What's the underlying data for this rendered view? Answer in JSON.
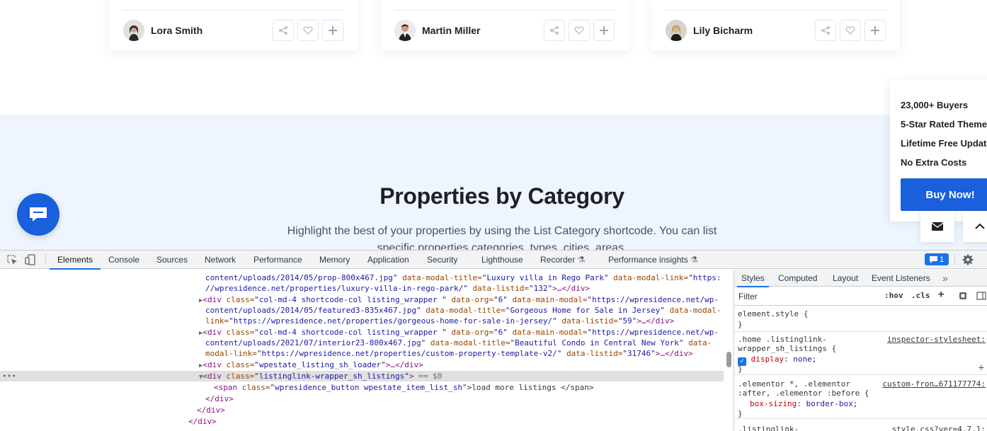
{
  "agents": [
    {
      "name": "Lora Smith"
    },
    {
      "name": "Martin Miller"
    },
    {
      "name": "Lily Bicharm"
    }
  ],
  "section": {
    "title": "Properties by Category",
    "description": "Highlight the best of your properties by using the List Category shortcode. You can list specific properties categories, types, cities, areas."
  },
  "promo": {
    "items": [
      "23,000+ Buyers",
      "5-Star Rated Theme",
      "Lifetime Free Updates",
      "No Extra Costs"
    ],
    "button": "Buy Now!"
  },
  "devtools": {
    "tabs": [
      "Elements",
      "Console",
      "Sources",
      "Network",
      "Performance",
      "Memory",
      "Application",
      "Security",
      "Lighthouse",
      "Recorder",
      "Performance insights"
    ],
    "active_tab": "Elements",
    "issues_count": "1",
    "styles_tabs": [
      "Styles",
      "Computed",
      "Layout",
      "Event Listeners"
    ],
    "filter_placeholder": "Filter",
    "hov": ":hov",
    "cls": ".cls",
    "styles": {
      "rule1_selector": "element.style {",
      "rule1_close": "}",
      "rule2_selector_line1": ".home .listinglink-",
      "rule2_selector_line2": "wrapper_sh_listings {",
      "rule2_source": "inspector-stylesheet:",
      "rule2_prop": "display",
      "rule2_val": "none;",
      "rule2_close": "}",
      "rule3_selector_line1": ".elementor *, .elementor",
      "rule3_selector_line2": ":after, .elementor :before {",
      "rule3_source": "custom-fron…671177774:",
      "rule3_prop": "box-sizing",
      "rule3_val": "border-box;",
      "rule3_close": "}",
      "rule4_selector": ".listinglink-",
      "rule4_source": "style.css?ver=4.7.1:"
    },
    "dom_lines": [
      {
        "text_a": "content/uploads/2014/05/prop-800x467.jpg\"",
        "text_b": " data-modal-title=",
        "text_c": "\"Luxury villa in Rego Park\"",
        "text_d": " data-modal-link=",
        "text_e": "\"https:"
      },
      {
        "text_a": "//wpresidence.net/properties/luxury-villa-in-rego-park/\"",
        "text_b": " data-listid=",
        "text_c": "\"132\"",
        "text_d": ">…</div>"
      },
      {
        "tag": "<div",
        "attr1": " class=",
        "val1": "\"col-md-4 shortcode-col listing_wrapper \"",
        "attr2": " data-org=",
        "val2": "\"6\"",
        "attr3": " data-main-modal=",
        "val3": "\"https://wpresidence.net/wp-"
      },
      {
        "val": "content/uploads/2014/05/featured3-835x467.jpg\"",
        "attr": " data-modal-title=",
        "val2": "\"Gorgeous Home for Sale in Jersey\"",
        "attr2": " data-modal-"
      },
      {
        "attr": "link=",
        "val": "\"https://wpresidence.net/properties/gorgeous-home-for-sale-in-jersey/\"",
        "attr2": " data-listid=",
        "val2": "\"59\"",
        "end": ">…</div>"
      },
      {
        "tag": "<div",
        "attr1": " class=",
        "val1": "\"col-md-4 shortcode-col listing_wrapper \"",
        "attr2": " data-org=",
        "val2": "\"6\"",
        "attr3": " data-main-modal=",
        "val3": "\"https://wpresidence.net/wp-"
      },
      {
        "val": "content/uploads/2021/07/interior23-800x467.jpg\"",
        "attr": " data-modal-title=",
        "val2": "\"Beautiful Condo in Central New York\"",
        "attr2": " data-"
      },
      {
        "attr": "modal-link=",
        "val": "\"https://wpresidence.net/properties/custom-property-template-v2/\"",
        "attr2": " data-listid=",
        "val2": "\"31746\"",
        "end": ">…</div>"
      },
      {
        "tag": "<div",
        "attr1": " class=",
        "val1": "\"wpestate_listing_sh_loader\"",
        "end": ">…</div>"
      },
      {
        "tag": "<div",
        "attr1": " class=",
        "val1": "\"listinglink-wrapper_sh_listings\"",
        "end": ">",
        "marker": " == $0"
      },
      {
        "tag": "<span",
        "attr1": " class=",
        "val1": "\"wpresidence_button wpestate_item_list_sh\"",
        "text": ">load more listings </span>"
      },
      {
        "tag": "</div>"
      },
      {
        "tag": "</div>"
      },
      {
        "tag": "</div>"
      }
    ],
    "dots": "•••"
  },
  "colors": {
    "accent": "#1a5fdc",
    "devtools_blue": "#1a73e8"
  }
}
